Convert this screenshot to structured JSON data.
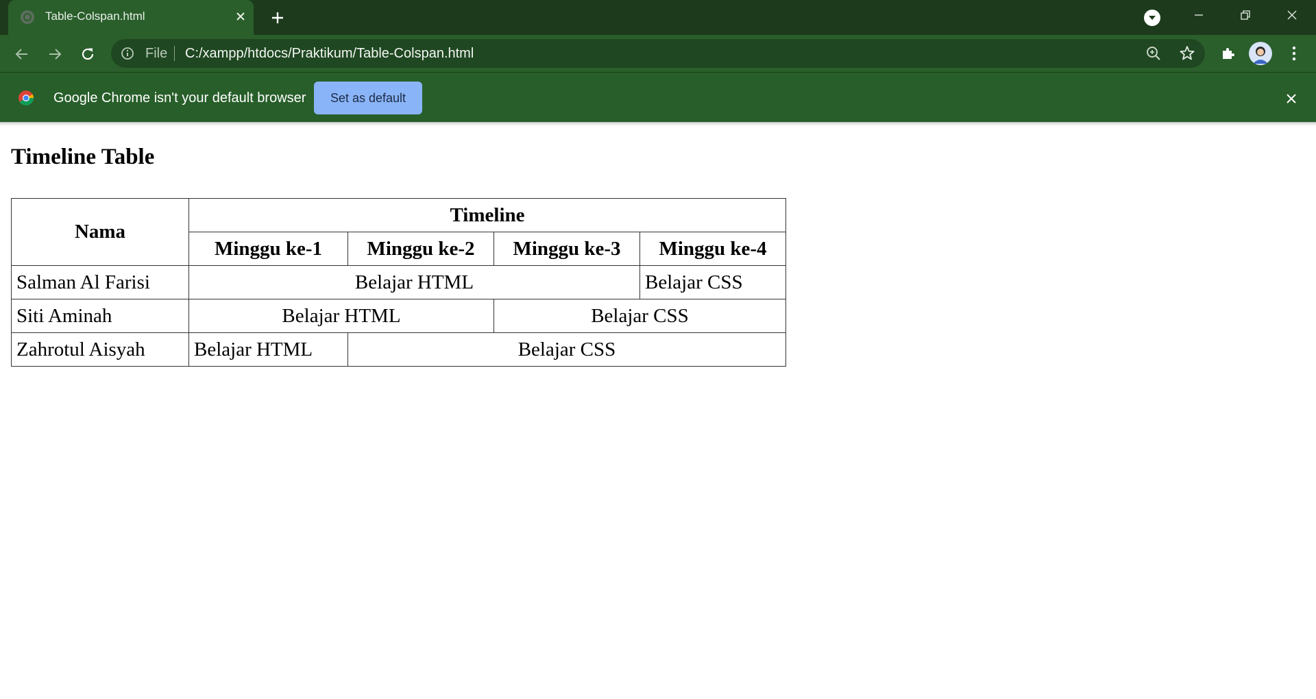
{
  "browser": {
    "tab": {
      "title": "Table-Colspan.html"
    },
    "omnibox": {
      "scheme_label": "File",
      "url": "C:/xampp/htdocs/Praktikum/Table-Colspan.html"
    },
    "infobar": {
      "message": "Google Chrome isn't your default browser",
      "button_label": "Set as default"
    },
    "colors": {
      "frame": "#1d3b1c",
      "toolbar": "#2a5f2b",
      "omnibox": "#1f4721",
      "accent_button": "#8ab4f8"
    }
  },
  "page": {
    "heading": "Timeline Table",
    "table": {
      "header_name": "Nama",
      "header_timeline": "Timeline",
      "weeks": [
        "Minggu ke-1",
        "Minggu ke-2",
        "Minggu ke-3",
        "Minggu ke-4"
      ],
      "rows": [
        {
          "name": "Salman Al Farisi",
          "cells": [
            "Belajar HTML",
            "Belajar CSS"
          ]
        },
        {
          "name": "Siti Aminah",
          "cells": [
            "Belajar HTML",
            "Belajar CSS"
          ]
        },
        {
          "name": "Zahrotul Aisyah",
          "cells": [
            "Belajar HTML",
            "Belajar CSS"
          ]
        }
      ]
    }
  }
}
